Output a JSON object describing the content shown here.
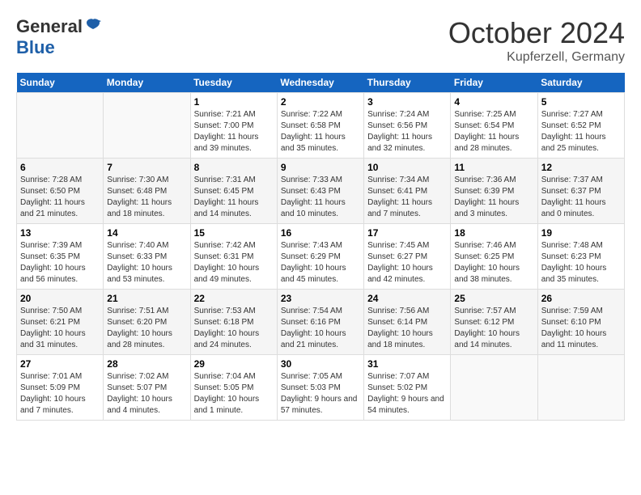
{
  "header": {
    "logo_general": "General",
    "logo_blue": "Blue",
    "month_title": "October 2024",
    "location": "Kupferzell, Germany"
  },
  "weekdays": [
    "Sunday",
    "Monday",
    "Tuesday",
    "Wednesday",
    "Thursday",
    "Friday",
    "Saturday"
  ],
  "weeks": [
    [
      {
        "day": "",
        "sunrise": "",
        "sunset": "",
        "daylight": ""
      },
      {
        "day": "",
        "sunrise": "",
        "sunset": "",
        "daylight": ""
      },
      {
        "day": "1",
        "sunrise": "Sunrise: 7:21 AM",
        "sunset": "Sunset: 7:00 PM",
        "daylight": "Daylight: 11 hours and 39 minutes."
      },
      {
        "day": "2",
        "sunrise": "Sunrise: 7:22 AM",
        "sunset": "Sunset: 6:58 PM",
        "daylight": "Daylight: 11 hours and 35 minutes."
      },
      {
        "day": "3",
        "sunrise": "Sunrise: 7:24 AM",
        "sunset": "Sunset: 6:56 PM",
        "daylight": "Daylight: 11 hours and 32 minutes."
      },
      {
        "day": "4",
        "sunrise": "Sunrise: 7:25 AM",
        "sunset": "Sunset: 6:54 PM",
        "daylight": "Daylight: 11 hours and 28 minutes."
      },
      {
        "day": "5",
        "sunrise": "Sunrise: 7:27 AM",
        "sunset": "Sunset: 6:52 PM",
        "daylight": "Daylight: 11 hours and 25 minutes."
      }
    ],
    [
      {
        "day": "6",
        "sunrise": "Sunrise: 7:28 AM",
        "sunset": "Sunset: 6:50 PM",
        "daylight": "Daylight: 11 hours and 21 minutes."
      },
      {
        "day": "7",
        "sunrise": "Sunrise: 7:30 AM",
        "sunset": "Sunset: 6:48 PM",
        "daylight": "Daylight: 11 hours and 18 minutes."
      },
      {
        "day": "8",
        "sunrise": "Sunrise: 7:31 AM",
        "sunset": "Sunset: 6:45 PM",
        "daylight": "Daylight: 11 hours and 14 minutes."
      },
      {
        "day": "9",
        "sunrise": "Sunrise: 7:33 AM",
        "sunset": "Sunset: 6:43 PM",
        "daylight": "Daylight: 11 hours and 10 minutes."
      },
      {
        "day": "10",
        "sunrise": "Sunrise: 7:34 AM",
        "sunset": "Sunset: 6:41 PM",
        "daylight": "Daylight: 11 hours and 7 minutes."
      },
      {
        "day": "11",
        "sunrise": "Sunrise: 7:36 AM",
        "sunset": "Sunset: 6:39 PM",
        "daylight": "Daylight: 11 hours and 3 minutes."
      },
      {
        "day": "12",
        "sunrise": "Sunrise: 7:37 AM",
        "sunset": "Sunset: 6:37 PM",
        "daylight": "Daylight: 11 hours and 0 minutes."
      }
    ],
    [
      {
        "day": "13",
        "sunrise": "Sunrise: 7:39 AM",
        "sunset": "Sunset: 6:35 PM",
        "daylight": "Daylight: 10 hours and 56 minutes."
      },
      {
        "day": "14",
        "sunrise": "Sunrise: 7:40 AM",
        "sunset": "Sunset: 6:33 PM",
        "daylight": "Daylight: 10 hours and 53 minutes."
      },
      {
        "day": "15",
        "sunrise": "Sunrise: 7:42 AM",
        "sunset": "Sunset: 6:31 PM",
        "daylight": "Daylight: 10 hours and 49 minutes."
      },
      {
        "day": "16",
        "sunrise": "Sunrise: 7:43 AM",
        "sunset": "Sunset: 6:29 PM",
        "daylight": "Daylight: 10 hours and 45 minutes."
      },
      {
        "day": "17",
        "sunrise": "Sunrise: 7:45 AM",
        "sunset": "Sunset: 6:27 PM",
        "daylight": "Daylight: 10 hours and 42 minutes."
      },
      {
        "day": "18",
        "sunrise": "Sunrise: 7:46 AM",
        "sunset": "Sunset: 6:25 PM",
        "daylight": "Daylight: 10 hours and 38 minutes."
      },
      {
        "day": "19",
        "sunrise": "Sunrise: 7:48 AM",
        "sunset": "Sunset: 6:23 PM",
        "daylight": "Daylight: 10 hours and 35 minutes."
      }
    ],
    [
      {
        "day": "20",
        "sunrise": "Sunrise: 7:50 AM",
        "sunset": "Sunset: 6:21 PM",
        "daylight": "Daylight: 10 hours and 31 minutes."
      },
      {
        "day": "21",
        "sunrise": "Sunrise: 7:51 AM",
        "sunset": "Sunset: 6:20 PM",
        "daylight": "Daylight: 10 hours and 28 minutes."
      },
      {
        "day": "22",
        "sunrise": "Sunrise: 7:53 AM",
        "sunset": "Sunset: 6:18 PM",
        "daylight": "Daylight: 10 hours and 24 minutes."
      },
      {
        "day": "23",
        "sunrise": "Sunrise: 7:54 AM",
        "sunset": "Sunset: 6:16 PM",
        "daylight": "Daylight: 10 hours and 21 minutes."
      },
      {
        "day": "24",
        "sunrise": "Sunrise: 7:56 AM",
        "sunset": "Sunset: 6:14 PM",
        "daylight": "Daylight: 10 hours and 18 minutes."
      },
      {
        "day": "25",
        "sunrise": "Sunrise: 7:57 AM",
        "sunset": "Sunset: 6:12 PM",
        "daylight": "Daylight: 10 hours and 14 minutes."
      },
      {
        "day": "26",
        "sunrise": "Sunrise: 7:59 AM",
        "sunset": "Sunset: 6:10 PM",
        "daylight": "Daylight: 10 hours and 11 minutes."
      }
    ],
    [
      {
        "day": "27",
        "sunrise": "Sunrise: 7:01 AM",
        "sunset": "Sunset: 5:09 PM",
        "daylight": "Daylight: 10 hours and 7 minutes."
      },
      {
        "day": "28",
        "sunrise": "Sunrise: 7:02 AM",
        "sunset": "Sunset: 5:07 PM",
        "daylight": "Daylight: 10 hours and 4 minutes."
      },
      {
        "day": "29",
        "sunrise": "Sunrise: 7:04 AM",
        "sunset": "Sunset: 5:05 PM",
        "daylight": "Daylight: 10 hours and 1 minute."
      },
      {
        "day": "30",
        "sunrise": "Sunrise: 7:05 AM",
        "sunset": "Sunset: 5:03 PM",
        "daylight": "Daylight: 9 hours and 57 minutes."
      },
      {
        "day": "31",
        "sunrise": "Sunrise: 7:07 AM",
        "sunset": "Sunset: 5:02 PM",
        "daylight": "Daylight: 9 hours and 54 minutes."
      },
      {
        "day": "",
        "sunrise": "",
        "sunset": "",
        "daylight": ""
      },
      {
        "day": "",
        "sunrise": "",
        "sunset": "",
        "daylight": ""
      }
    ]
  ]
}
